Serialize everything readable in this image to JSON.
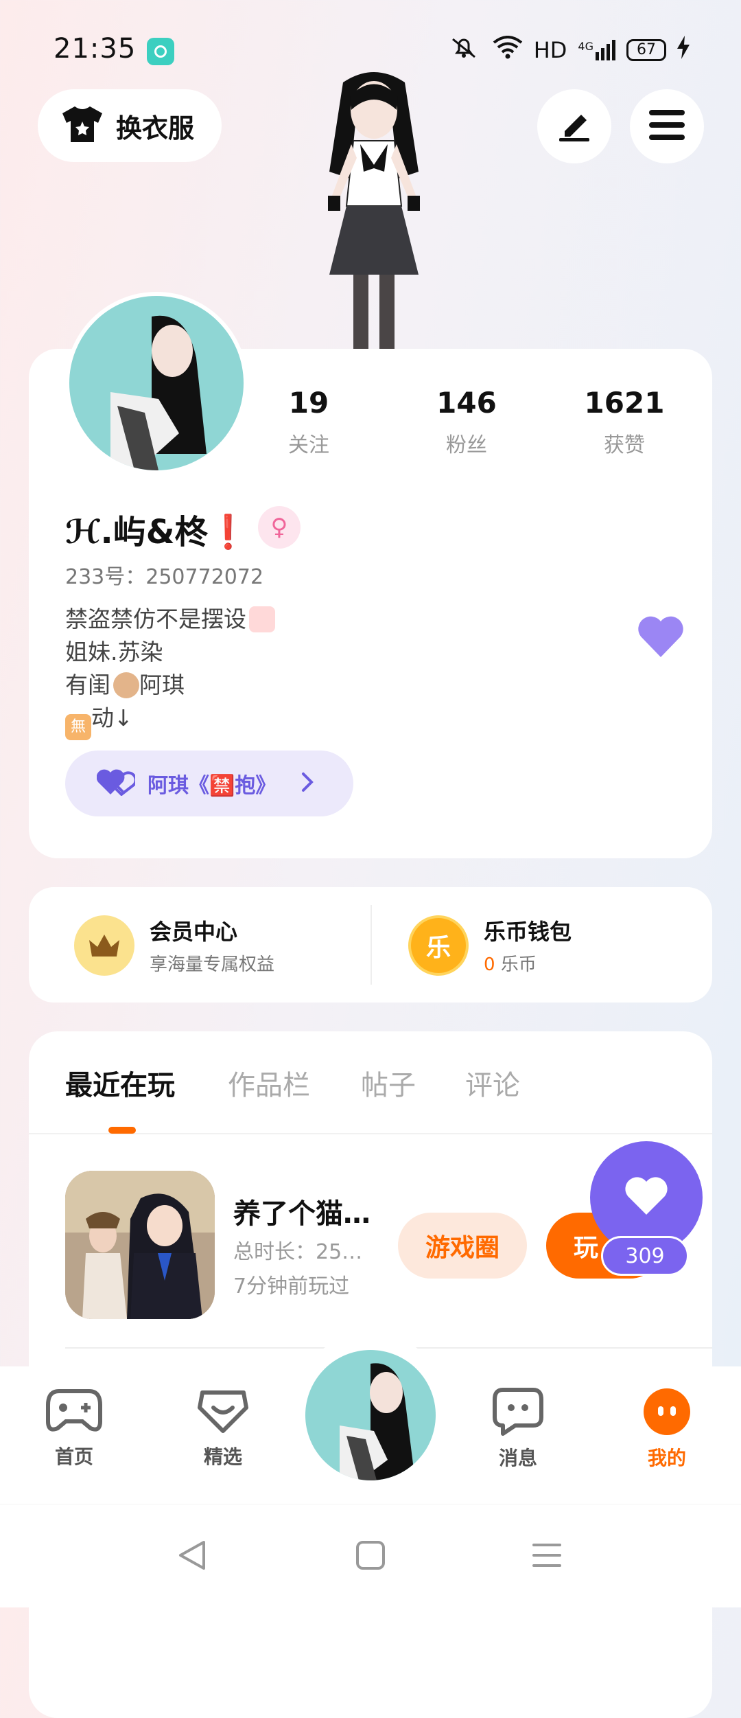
{
  "status_bar": {
    "time": "21:35",
    "network": "HD",
    "signal": "4G",
    "battery": "67"
  },
  "header": {
    "dress_label": "换衣服"
  },
  "profile": {
    "stats": [
      {
        "value": "19",
        "label": "关注"
      },
      {
        "value": "146",
        "label": "粉丝"
      },
      {
        "value": "1621",
        "label": "获赞"
      }
    ],
    "nickname": "ℋ.屿&柊❗",
    "gender_symbol": "♀",
    "uid": "233号：250772072",
    "bio": [
      "禁盗禁仿不是摆设",
      "姐妹.苏染",
      "有闺",
      "阿琪",
      "無",
      "动↓"
    ],
    "relation_pill": "阿琪《🈲抱》"
  },
  "member": {
    "vip_title": "会员中心",
    "vip_sub": "享海量专属权益",
    "wallet_title": "乐币钱包",
    "wallet_amount": "0",
    "wallet_unit": "乐币",
    "coin_char": "乐"
  },
  "tabs": [
    "最近在玩",
    "作品栏",
    "帖子",
    "评论"
  ],
  "game": {
    "title": "养了个猫…",
    "duration": "总时长：25…",
    "last_played": "7分钟前玩过",
    "circle_button": "游戏圈",
    "play_button": "玩"
  },
  "likes": {
    "count": "309"
  },
  "bottom_nav": [
    {
      "label": "首页",
      "icon": "gamepad-icon"
    },
    {
      "label": "精选",
      "icon": "heart-box-icon"
    },
    {
      "label": "消息",
      "icon": "chat-icon"
    },
    {
      "label": "我的",
      "icon": "me-icon"
    }
  ],
  "colors": {
    "accent": "#ff6a00",
    "purple": "#7b64ef"
  }
}
